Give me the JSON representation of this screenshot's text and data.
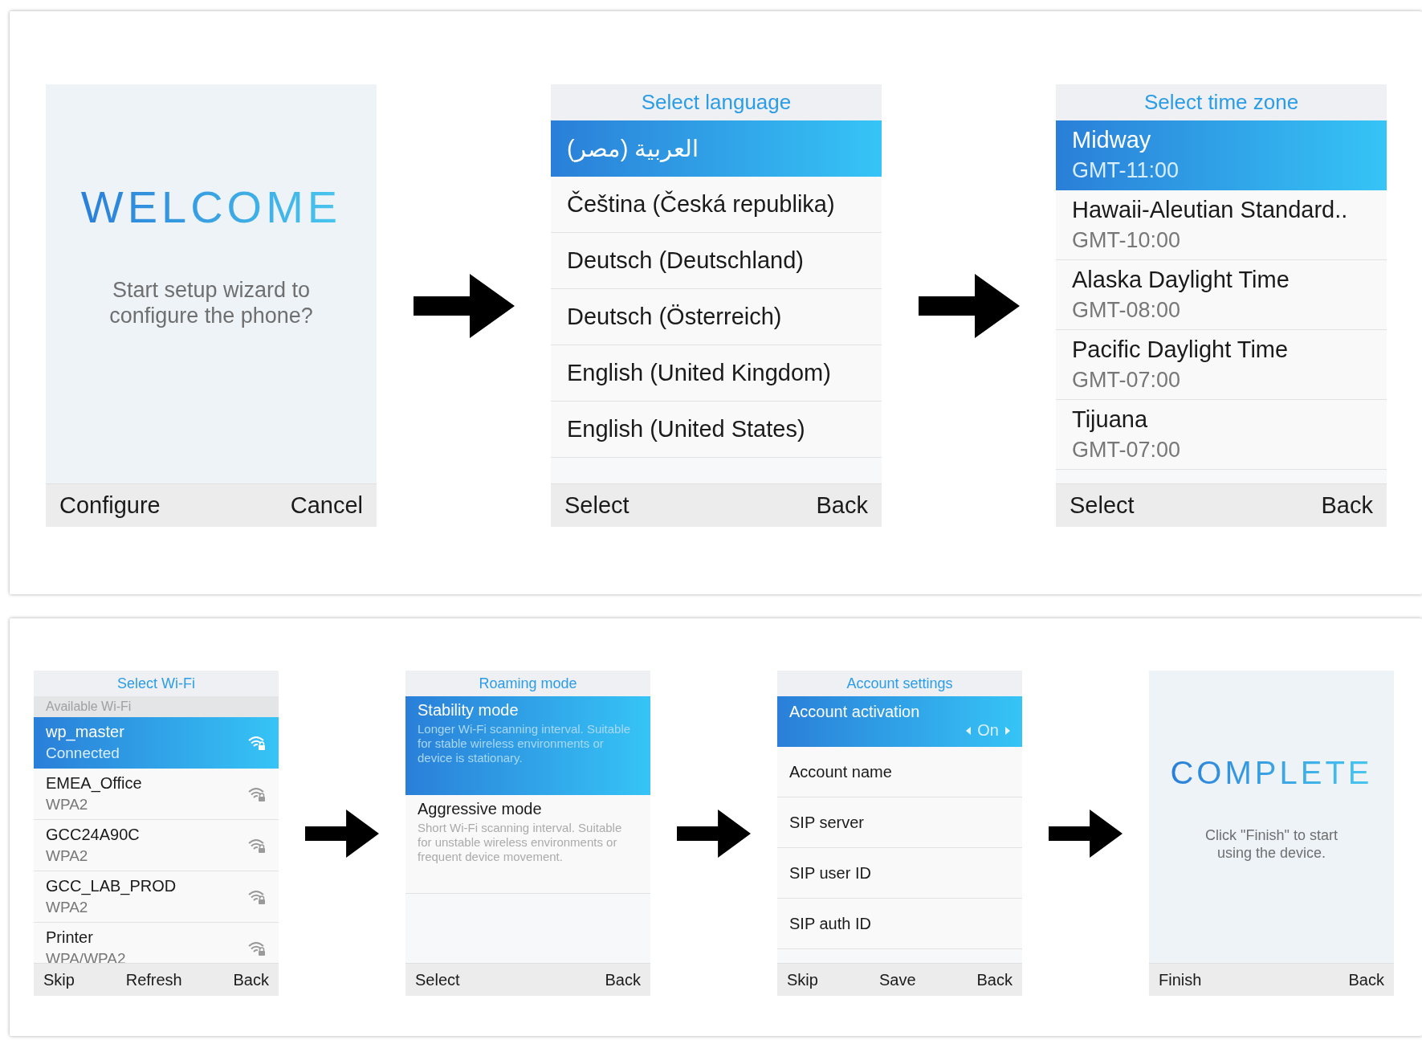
{
  "panels": [
    {
      "screens": [
        {
          "kind": "splash",
          "heading": "WELCOME",
          "message": "Start setup wizard to configure the phone?",
          "softkeys": [
            "Configure",
            "Cancel"
          ]
        },
        {
          "kind": "list",
          "title": "Select language",
          "items": [
            {
              "kind": "single",
              "label": "العربية (مصر)",
              "selected": true
            },
            {
              "kind": "single",
              "label": "Čeština (Česká republika)",
              "selected": false
            },
            {
              "kind": "single",
              "label": "Deutsch (Deutschland)",
              "selected": false
            },
            {
              "kind": "single",
              "label": "Deutsch (Österreich)",
              "selected": false
            },
            {
              "kind": "single",
              "label": "English (United Kingdom)",
              "selected": false
            },
            {
              "kind": "single",
              "label": "English (United States)",
              "selected": false
            }
          ],
          "softkeys": [
            "Select",
            "Back"
          ]
        },
        {
          "kind": "list",
          "title": "Select time zone",
          "items": [
            {
              "kind": "double",
              "label": "Midway",
              "sub": "GMT-11:00",
              "selected": true
            },
            {
              "kind": "double",
              "label": "Hawaii-Aleutian Standard..",
              "sub": "GMT-10:00",
              "selected": false
            },
            {
              "kind": "double",
              "label": "Alaska Daylight Time",
              "sub": "GMT-08:00",
              "selected": false
            },
            {
              "kind": "double",
              "label": "Pacific Daylight Time",
              "sub": "GMT-07:00",
              "selected": false
            },
            {
              "kind": "double",
              "label": "Tijuana",
              "sub": "GMT-07:00",
              "selected": false
            }
          ],
          "softkeys": [
            "Select",
            "Back"
          ]
        }
      ]
    },
    {
      "screens": [
        {
          "kind": "list",
          "title": "Select Wi-Fi",
          "subheader": "Available Wi-Fi",
          "items": [
            {
              "kind": "network",
              "label": "wp_master",
              "sub": "Connected",
              "selected": true
            },
            {
              "kind": "network",
              "label": "EMEA_Office",
              "sub": "WPA2",
              "selected": false
            },
            {
              "kind": "network",
              "label": "GCC24A90C",
              "sub": "WPA2",
              "selected": false
            },
            {
              "kind": "network",
              "label": "GCC_LAB_PROD",
              "sub": "WPA2",
              "selected": false
            },
            {
              "kind": "network",
              "label": "Printer",
              "sub": "WPA/WPA2",
              "selected": false
            }
          ],
          "softkeys": [
            "Skip",
            "Refresh",
            "Back"
          ]
        },
        {
          "kind": "list",
          "title": "Roaming mode",
          "items": [
            {
              "kind": "detail",
              "label": "Stability mode",
              "sub": "Longer Wi-Fi scanning interval. Suitable for stable wireless environments or device is stationary.",
              "selected": true
            },
            {
              "kind": "detail",
              "label": "Aggressive mode",
              "sub": "Short Wi-Fi scanning interval. Suitable for unstable wireless environments or frequent device movement.",
              "selected": false
            }
          ],
          "softkeys": [
            "Select",
            "Back"
          ]
        },
        {
          "kind": "list",
          "title": "Account settings",
          "items": [
            {
              "kind": "toggle",
              "label": "Account activation",
              "value": "On",
              "selected": true
            },
            {
              "kind": "single",
              "label": "Account name",
              "selected": false
            },
            {
              "kind": "single",
              "label": "SIP server",
              "selected": false
            },
            {
              "kind": "single",
              "label": "SIP user ID",
              "selected": false
            },
            {
              "kind": "single",
              "label": "SIP auth ID",
              "selected": false
            }
          ],
          "softkeys": [
            "Skip",
            "Save",
            "Back"
          ]
        },
        {
          "kind": "splash",
          "heading": "COMPLETE",
          "message": "Click \"Finish\" to start using the device.",
          "softkeys": [
            "Finish",
            "Back"
          ]
        }
      ]
    }
  ]
}
